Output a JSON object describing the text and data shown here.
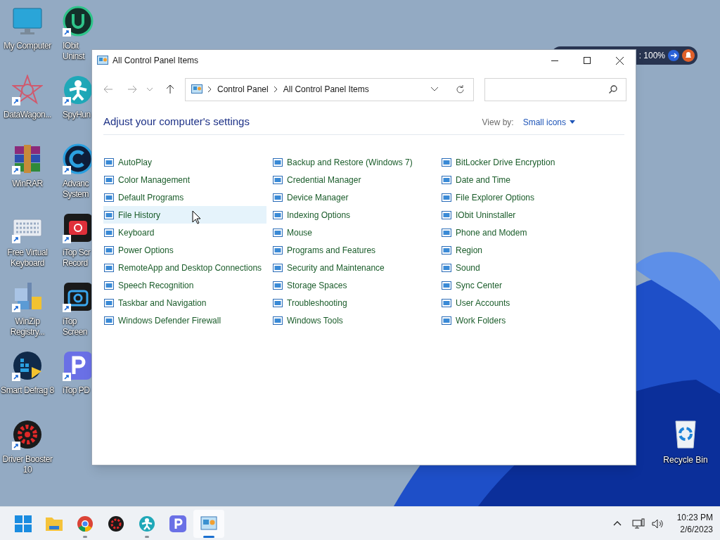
{
  "desktop_icons": [
    {
      "label": "My Computer",
      "kind": "monitor",
      "shortcut": false
    },
    {
      "label": "DataWagon...",
      "kind": "star",
      "shortcut": true
    },
    {
      "label": "WinRAR",
      "kind": "archive",
      "shortcut": true
    },
    {
      "label": "Free Virtual Keyboard",
      "kind": "keyboard",
      "shortcut": true
    },
    {
      "label": "WinZip Registry...",
      "kind": "zip",
      "shortcut": true
    },
    {
      "label": "Smart Defrag 8",
      "kind": "defrag",
      "shortcut": true
    },
    {
      "label": "Driver Booster 10",
      "kind": "gear",
      "shortcut": true
    }
  ],
  "desktop_icons_2": [
    {
      "label": "IObit Uninst",
      "kind": "u"
    },
    {
      "label": "SpyHun",
      "kind": "person"
    },
    {
      "label": "Advanc System",
      "kind": "c"
    },
    {
      "label": "iTop Scr Record",
      "kind": "rec"
    },
    {
      "label": "iTop Screen",
      "kind": "camera"
    },
    {
      "label": "iTop PD",
      "kind": "p"
    }
  ],
  "recycle_bin": {
    "label": "Recycle Bin"
  },
  "background_widget": {
    "text": ": 100%"
  },
  "window": {
    "title": "All Control Panel Items",
    "breadcrumb": [
      "Control Panel",
      "All Control Panel Items"
    ],
    "heading": "Adjust your computer's settings",
    "view_by": {
      "label": "View by:",
      "value": "Small icons"
    },
    "columns": [
      [
        {
          "label": "AutoPlay",
          "highlighted": false
        },
        {
          "label": "Color Management",
          "highlighted": false
        },
        {
          "label": "Default Programs",
          "highlighted": false
        },
        {
          "label": "File History",
          "highlighted": true
        },
        {
          "label": "Keyboard",
          "highlighted": false
        },
        {
          "label": "Power Options",
          "highlighted": false
        },
        {
          "label": "RemoteApp and Desktop Connections",
          "highlighted": false
        },
        {
          "label": "Speech Recognition",
          "highlighted": false
        },
        {
          "label": "Taskbar and Navigation",
          "highlighted": false
        },
        {
          "label": "Windows Defender Firewall",
          "highlighted": false
        }
      ],
      [
        {
          "label": "Backup and Restore (Windows 7)",
          "highlighted": false
        },
        {
          "label": "Credential Manager",
          "highlighted": false
        },
        {
          "label": "Device Manager",
          "highlighted": false
        },
        {
          "label": "Indexing Options",
          "highlighted": false
        },
        {
          "label": "Mouse",
          "highlighted": false
        },
        {
          "label": "Programs and Features",
          "highlighted": false
        },
        {
          "label": "Security and Maintenance",
          "highlighted": false
        },
        {
          "label": "Storage Spaces",
          "highlighted": false
        },
        {
          "label": "Troubleshooting",
          "highlighted": false
        },
        {
          "label": "Windows Tools",
          "highlighted": false
        }
      ],
      [
        {
          "label": "BitLocker Drive Encryption",
          "highlighted": false
        },
        {
          "label": "Date and Time",
          "highlighted": false
        },
        {
          "label": "File Explorer Options",
          "highlighted": false
        },
        {
          "label": "IObit Uninstaller",
          "highlighted": false
        },
        {
          "label": "Phone and Modem",
          "highlighted": false
        },
        {
          "label": "Region",
          "highlighted": false
        },
        {
          "label": "Sound",
          "highlighted": false
        },
        {
          "label": "Sync Center",
          "highlighted": false
        },
        {
          "label": "User Accounts",
          "highlighted": false
        },
        {
          "label": "Work Folders",
          "highlighted": false
        }
      ]
    ]
  },
  "taskbar": {
    "apps": [
      {
        "kind": "start",
        "running": false,
        "active": false
      },
      {
        "kind": "folder",
        "running": false,
        "active": false
      },
      {
        "kind": "chrome",
        "running": true,
        "active": false
      },
      {
        "kind": "gear",
        "running": false,
        "active": false
      },
      {
        "kind": "person",
        "running": true,
        "active": false
      },
      {
        "kind": "p",
        "running": false,
        "active": false
      },
      {
        "kind": "panel",
        "running": true,
        "active": true
      }
    ],
    "time": "10:23 PM",
    "date": "2/6/2023"
  }
}
